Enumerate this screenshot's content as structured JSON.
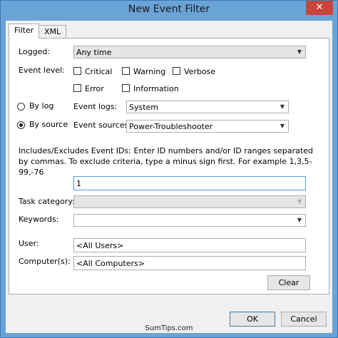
{
  "window": {
    "title": "New Event Filter",
    "close_glyph": "✕"
  },
  "tabs": [
    {
      "label": "Filter",
      "active": true
    },
    {
      "label": "XML",
      "active": false
    }
  ],
  "filter": {
    "logged_label": "Logged:",
    "logged_value": "Any time",
    "event_level_label": "Event level:",
    "levels": {
      "critical": "Critical",
      "warning": "Warning",
      "verbose": "Verbose",
      "error": "Error",
      "information": "Information"
    },
    "by_log_label": "By log",
    "by_source_label": "By source",
    "event_logs_label": "Event logs:",
    "event_logs_value": "System",
    "event_sources_label": "Event sources:",
    "event_sources_value": "Power-Troubleshooter",
    "description": "Includes/Excludes Event IDs: Enter ID numbers and/or ID ranges separated by commas. To exclude criteria, type a minus sign first. For example 1,3,5-99,-76",
    "event_ids_value": "1",
    "task_category_label": "Task category:",
    "task_category_value": "",
    "keywords_label": "Keywords:",
    "keywords_value": "",
    "user_label": "User:",
    "user_value": "<All Users>",
    "computers_label": "Computer(s):",
    "computers_value": "<All Computers>",
    "clear_label": "Clear"
  },
  "buttons": {
    "ok": "OK",
    "cancel": "Cancel"
  },
  "watermark": "SumTips.com",
  "icons": {
    "dropdown": "chevron-down-icon",
    "close": "close-icon"
  }
}
